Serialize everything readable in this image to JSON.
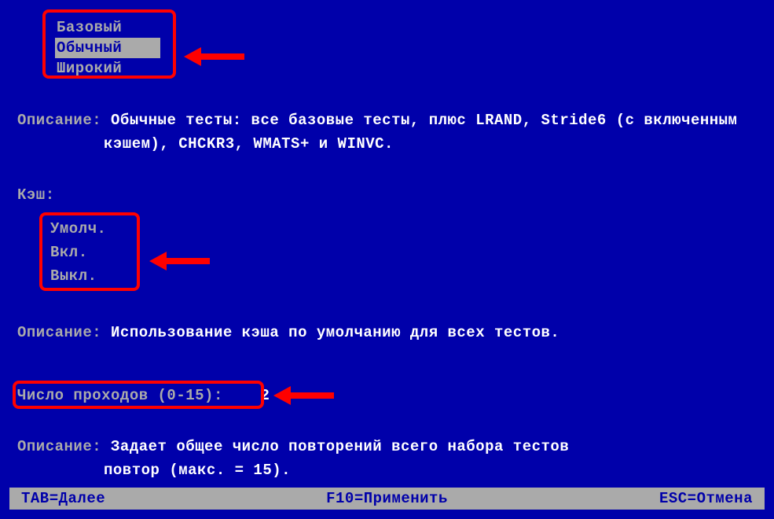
{
  "test_mix": {
    "items": [
      "Базовый",
      "Обычный",
      "Широкий"
    ],
    "selected_index": 1
  },
  "desc1": {
    "label": "Описание:",
    "line1": "Обычные тесты: все базовые тесты, плюс LRAND, Stride6 (с включенным",
    "line2": "кэшем), CHCKR3, WMATS+ и WINVC."
  },
  "cache": {
    "label": "Кэш:",
    "items": [
      "Умолч.",
      "Вкл.",
      "Выкл."
    ]
  },
  "desc2": {
    "label": "Описание:",
    "text": "Использование кэша по умолчанию для всех тестов."
  },
  "passes": {
    "label": "Число проходов (0-15):",
    "value": "2"
  },
  "desc3": {
    "label": "Описание:",
    "line1": "Задает общее число повторений всего набора тестов",
    "line2": "повтор (макс. = 15)."
  },
  "footer": {
    "tab": "TAB=Далее",
    "f10": "F10=Применить",
    "esc": "ESC=Отмена"
  }
}
